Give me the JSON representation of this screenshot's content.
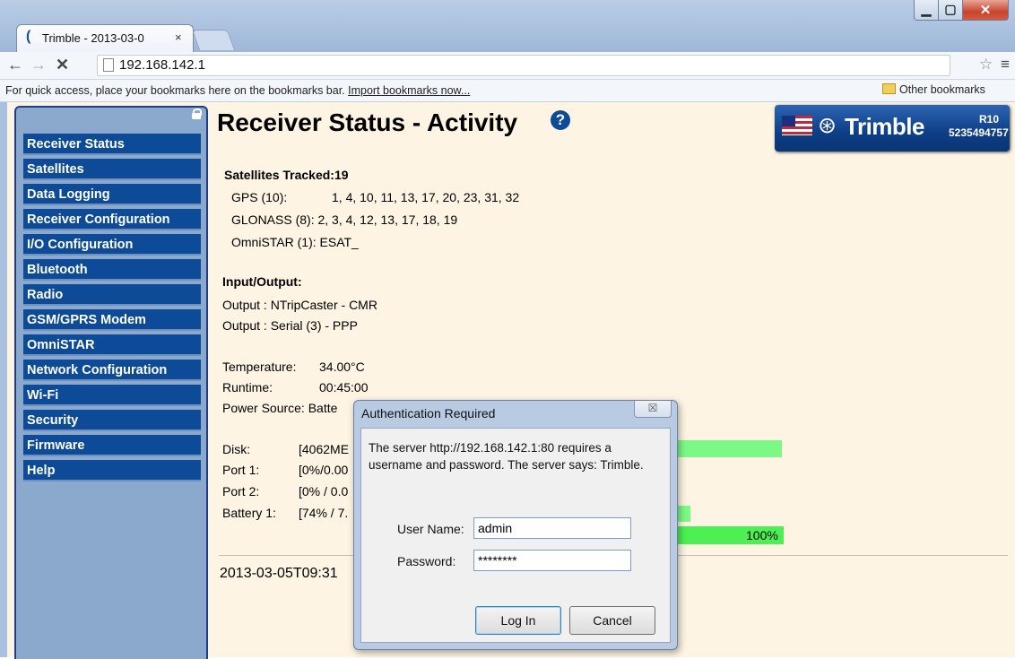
{
  "browser": {
    "tab_title": "Trimble - 2013-03-0",
    "tab_close": "×",
    "url": "192.168.142.1",
    "bookmarks_bar_text": "For quick access, place your bookmarks here on the bookmarks bar. ",
    "import_bookmarks_link": "Import bookmarks now...",
    "other_bookmarks": "Other bookmarks"
  },
  "sidebar": {
    "items": [
      {
        "label": "Receiver Status"
      },
      {
        "label": "Satellites"
      },
      {
        "label": "Data Logging"
      },
      {
        "label": "Receiver Configuration"
      },
      {
        "label": "I/O Configuration"
      },
      {
        "label": "Bluetooth"
      },
      {
        "label": "Radio"
      },
      {
        "label": "GSM/GPRS Modem"
      },
      {
        "label": "OmniSTAR"
      },
      {
        "label": "Network Configuration"
      },
      {
        "label": "Wi-Fi"
      },
      {
        "label": "Security"
      },
      {
        "label": "Firmware"
      },
      {
        "label": "Help"
      }
    ]
  },
  "page": {
    "title": "Receiver Status - Activity",
    "help_glyph": "?",
    "logo": {
      "brand": "Trimble",
      "model": "R10",
      "serial": "5235494757"
    }
  },
  "satellites": {
    "heading": "Satellites Tracked:19",
    "gps_label": "GPS (10):",
    "gps_values": "1, 4, 10, 11, 13, 17, 20, 23, 31, 32",
    "glonass": "GLONASS (8): 2, 3, 4, 12, 13, 17, 18, 19",
    "omnistar": "OmniSTAR (1): ESAT_"
  },
  "io": {
    "heading": "Input/Output:",
    "output1": "Output : NTripCaster - CMR",
    "output2": "Output : Serial (3) - PPP"
  },
  "status": {
    "temperature_label": "Temperature:",
    "temperature_value": "34.00°C",
    "runtime_label": "Runtime:",
    "runtime_value": "00:45:00",
    "power_source": "Power Source: Batte"
  },
  "resources": {
    "disk_label": "Disk:",
    "disk_value": "[4062ME",
    "port1_label": "Port 1:",
    "port1_value": "[0%/0.00",
    "port2_label": "Port 2:",
    "port2_value": "[0% / 0.0",
    "battery_label": "Battery 1:",
    "battery_value": "[74% / 7.",
    "power_percent": "100%"
  },
  "timestamp": "2013-03-05T09:31",
  "dialog": {
    "title": "Authentication Required",
    "close_glyph": "☒",
    "message": "The server http://192.168.142.1:80 requires a username and password. The server says: Trimble.",
    "username_label": "User Name:",
    "username_value": "admin",
    "password_label": "Password:",
    "password_value": "********",
    "login_button": "Log In",
    "cancel_button": "Cancel"
  }
}
